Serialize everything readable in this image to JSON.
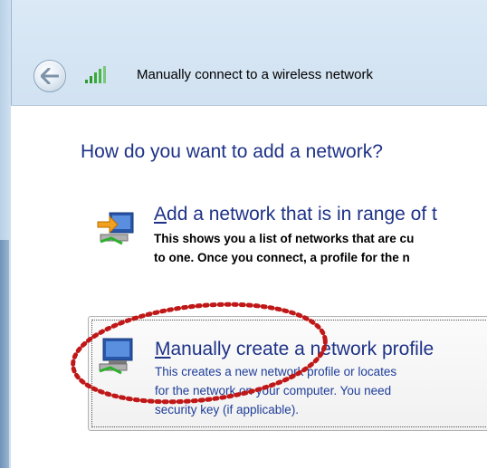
{
  "window": {
    "title": "Manually connect to a wireless network",
    "back_icon": "back-arrow-icon",
    "network_icon": "wireless-signal-icon"
  },
  "main": {
    "heading": "How do you want to add a network?",
    "options": [
      {
        "title_underlined": "A",
        "title_rest": "dd a network that is in range of t",
        "desc": [
          "This shows you a list of networks that are cu",
          "to one. Once you connect, a profile for the n"
        ],
        "icon": "network-arrow-icon"
      },
      {
        "title_underlined": "M",
        "title_rest": "anually create a network profile",
        "desc": [
          "This creates a new network profile or locates",
          "for the network on your computer. You need",
          "security key (if applicable)."
        ],
        "icon": "network-computer-icon"
      }
    ]
  },
  "colors": {
    "heading": "#1e3287",
    "annotation": "#c01818"
  }
}
